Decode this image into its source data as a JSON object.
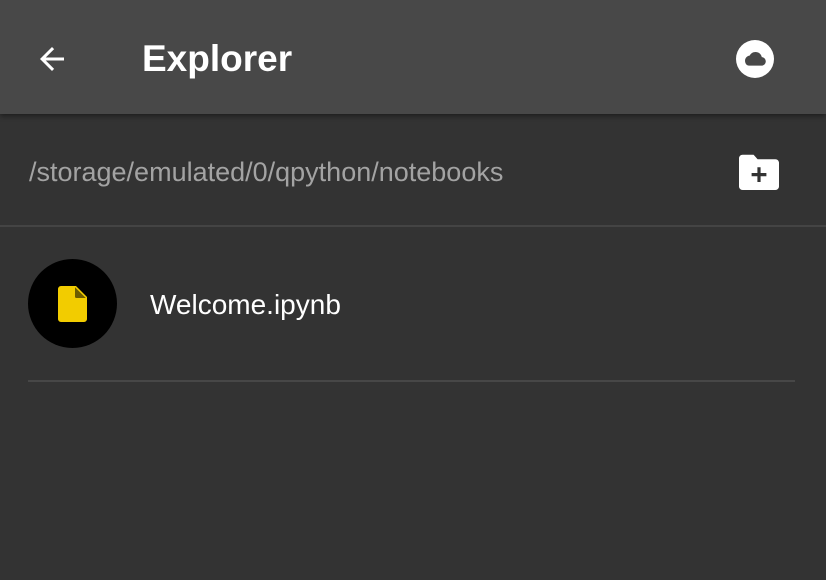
{
  "toolbar": {
    "back_icon": "arrow-back-icon",
    "title": "Explorer",
    "cloud_icon": "cloud-icon"
  },
  "path_bar": {
    "path": "/storage/emulated/0/qpython/notebooks",
    "new_folder_icon": "create-new-folder-icon"
  },
  "files": [
    {
      "name": "Welcome.ipynb",
      "icon": "file-icon",
      "icon_color": "#f2cc00"
    }
  ],
  "colors": {
    "toolbar_bg": "#484848",
    "background": "#333333",
    "path_text": "#a3a3a3",
    "file_icon": "#f2cc00"
  }
}
